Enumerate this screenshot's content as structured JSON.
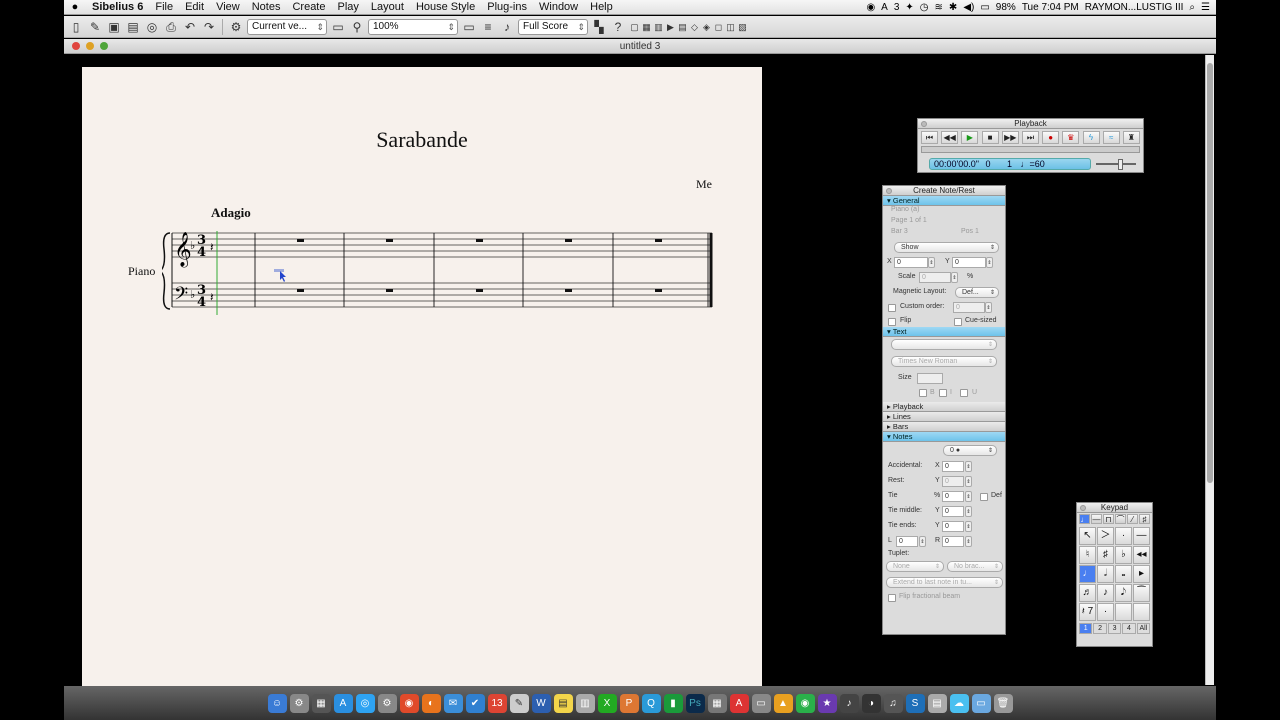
{
  "menubar": {
    "app": "Sibelius 6",
    "items": [
      "File",
      "Edit",
      "View",
      "Notes",
      "Create",
      "Play",
      "Layout",
      "House Style",
      "Plug-ins",
      "Window",
      "Help"
    ],
    "battery": "98%",
    "clock": "Tue 7:04 PM",
    "user": "RAYMON...LUSTIG III",
    "badge": "3"
  },
  "toolbar": {
    "version_select": "Current ve...",
    "zoom_select": "100%",
    "view_select": "Full Score"
  },
  "window": {
    "title": "untitled 3"
  },
  "score": {
    "title": "Sarabande",
    "composer": "Me",
    "tempo": "Adagio",
    "instrument": "Piano",
    "time_signature": "3/4"
  },
  "playback": {
    "title": "Playback",
    "time": "00:00'00.0\"",
    "bar": "0",
    "beat": "1",
    "tempo": "♩=60"
  },
  "inspector": {
    "title": "Create Note/Rest",
    "general": {
      "label": "General",
      "staff": "Piano (a)",
      "page": "Page 1 of 1",
      "bar": "Bar 3",
      "pos": "Pos 1",
      "show": "Show",
      "x": "0",
      "y": "0",
      "scale_label": "Scale",
      "scale": "0",
      "pct": "%",
      "magnetic_label": "Magnetic Layout:",
      "magnetic": "Def...",
      "custom_order": "Custom order:",
      "custom_value": "0",
      "flip": "Flip",
      "cue": "Cue-sized"
    },
    "text": {
      "label": "Text",
      "font": "Times New Roman",
      "size_label": "Size",
      "b": "B",
      "i": "I",
      "u": "U"
    },
    "closed_sections": [
      "Playback",
      "Lines",
      "Bars"
    ],
    "notes": {
      "label": "Notes",
      "notehead": "0",
      "accidental": "Accidental:",
      "rest": "Rest:",
      "tie": "Tie",
      "tie_middle": "Tie middle:",
      "tie_ends": "Tie ends:",
      "l_label": "L",
      "r_label": "R",
      "tuplet": "Tuplet:",
      "tuplet_val": "None",
      "bracket_val": "No brac...",
      "extend": "Extend to last note in tu...",
      "flip_beam": "Flip fractional beam",
      "def": "Def",
      "zero": "0"
    }
  },
  "keypad": {
    "title": "Keypad",
    "keys": [
      "↖",
      "＞",
      "·",
      "—",
      "♮",
      "♯",
      "♭",
      "◂◂",
      "♩",
      "𝅗𝅥",
      "𝅝",
      "▸",
      "♬",
      "♪",
      "𝅘𝅥𝅮",
      "⁀",
      "𝄽 7",
      "·",
      "",
      ""
    ],
    "layers": [
      "1",
      "2",
      "3",
      "4",
      "All"
    ]
  },
  "dock": [
    "Finder",
    "Chrome",
    "Firefox",
    "Mail",
    "Notes",
    "Photoshop",
    "Spotify",
    "Skype",
    "Safari",
    "Trash"
  ]
}
